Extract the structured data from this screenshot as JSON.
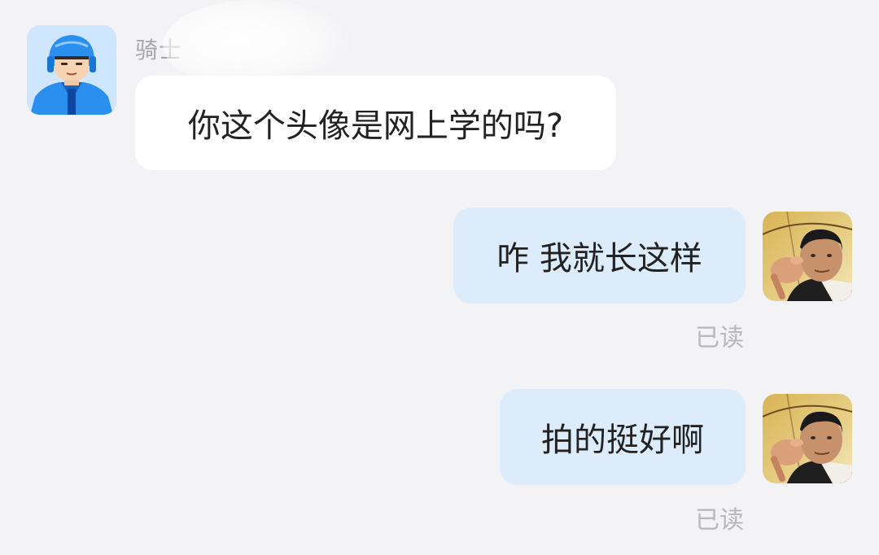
{
  "conversation": {
    "sender_name": "骑士",
    "messages": [
      {
        "from": "other",
        "avatar": "rider-avatar-icon",
        "text": "你这个头像是网上学的吗?"
      },
      {
        "from": "self",
        "avatar": "user-photo-avatar",
        "text": "咋 我就长这样",
        "status": "已读"
      },
      {
        "from": "self",
        "avatar": "user-photo-avatar",
        "text": "拍的挺好啊",
        "status": "已读"
      }
    ]
  },
  "colors": {
    "background": "#f3f3f5",
    "incoming_bubble": "#ffffff",
    "outgoing_bubble": "#dcecfb",
    "rider_blue": "#2b8ff0",
    "status_text": "#b7b7bc"
  }
}
